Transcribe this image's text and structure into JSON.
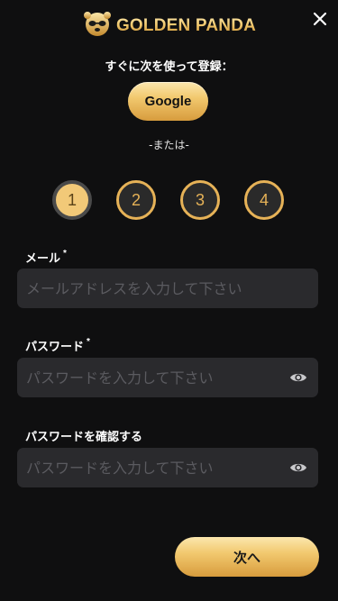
{
  "brand": {
    "name": "GOLDEN PANDA",
    "logo_icon": "panda-coin-icon"
  },
  "close_icon": "close-icon",
  "signup": {
    "label": "すぐに次を使って登録：",
    "google_label": "Google"
  },
  "divider": {
    "label": "-または-"
  },
  "steps": [
    "1",
    "2",
    "3",
    "4"
  ],
  "active_step": 1,
  "fields": {
    "email": {
      "label": "メール",
      "required_mark": "*",
      "placeholder": "メールアドレスを入力して下さい",
      "value": ""
    },
    "password": {
      "label": "パスワード",
      "required_mark": "*",
      "placeholder": "パスワードを入力して下さい",
      "value": "",
      "toggle_icon": "eye-icon"
    },
    "confirm_password": {
      "label": "パスワードを確認する",
      "placeholder": "パスワードを入力して下さい",
      "value": "",
      "toggle_icon": "eye-icon"
    }
  },
  "next_button": {
    "label": "次へ"
  },
  "colors": {
    "background": "#0f0f10",
    "gold": "#f2c96f",
    "input_bg": "#2a2a2d"
  }
}
